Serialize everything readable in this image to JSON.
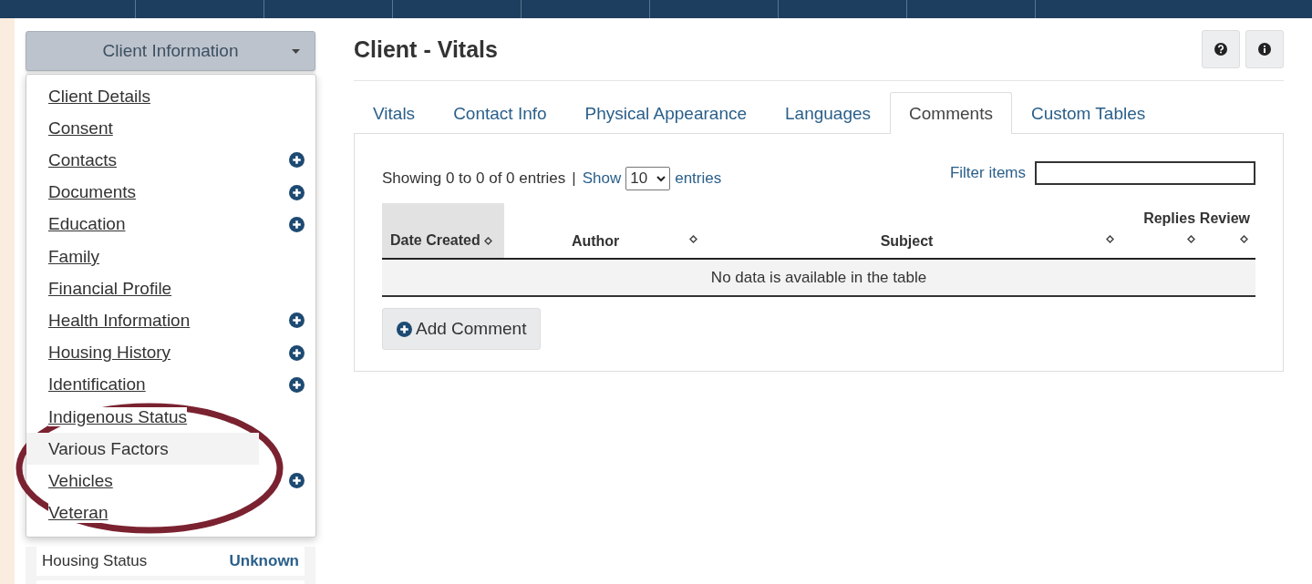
{
  "dropdown": {
    "label": "Client Information"
  },
  "menu": [
    {
      "label": "Client Details",
      "add": false,
      "selected": false
    },
    {
      "label": "Consent",
      "add": false,
      "selected": false
    },
    {
      "label": "Contacts",
      "add": true,
      "selected": false
    },
    {
      "label": "Documents",
      "add": true,
      "selected": false
    },
    {
      "label": "Education",
      "add": true,
      "selected": false
    },
    {
      "label": "Family",
      "add": false,
      "selected": false
    },
    {
      "label": "Financial Profile",
      "add": false,
      "selected": false
    },
    {
      "label": "Health Information",
      "add": true,
      "selected": false
    },
    {
      "label": "Housing History",
      "add": true,
      "selected": false
    },
    {
      "label": "Identification",
      "add": true,
      "selected": false
    },
    {
      "label": "Indigenous Status",
      "add": false,
      "selected": false
    },
    {
      "label": "Various Factors",
      "add": false,
      "selected": true
    },
    {
      "label": "Vehicles",
      "add": true,
      "selected": false
    },
    {
      "label": "Veteran",
      "add": false,
      "selected": false
    }
  ],
  "summary": [
    {
      "label": "Housing Status",
      "value": "Unknown",
      "kind": "link"
    }
  ],
  "page": {
    "title": "Client - Vitals"
  },
  "tabs": [
    {
      "label": "Vitals",
      "selected": false
    },
    {
      "label": "Contact Info",
      "selected": false
    },
    {
      "label": "Physical Appearance",
      "selected": false
    },
    {
      "label": "Languages",
      "selected": false
    },
    {
      "label": "Comments",
      "selected": true
    },
    {
      "label": "Custom Tables",
      "selected": false
    }
  ],
  "table_info": {
    "showing": "Showing 0 to 0 of 0 entries",
    "separator": "|",
    "show": "Show",
    "page_size": "10",
    "entries": "entries",
    "filter_label": "Filter items"
  },
  "table": {
    "columns": [
      {
        "label": "Date Created",
        "sorted": true
      },
      {
        "label": "Author",
        "sorted": false
      },
      {
        "label": "Subject",
        "sorted": false
      },
      {
        "label": "Replies",
        "sorted": false
      },
      {
        "label": "Review",
        "sorted": false
      }
    ],
    "empty": "No data is available in the table"
  },
  "add_button": "Add Comment"
}
